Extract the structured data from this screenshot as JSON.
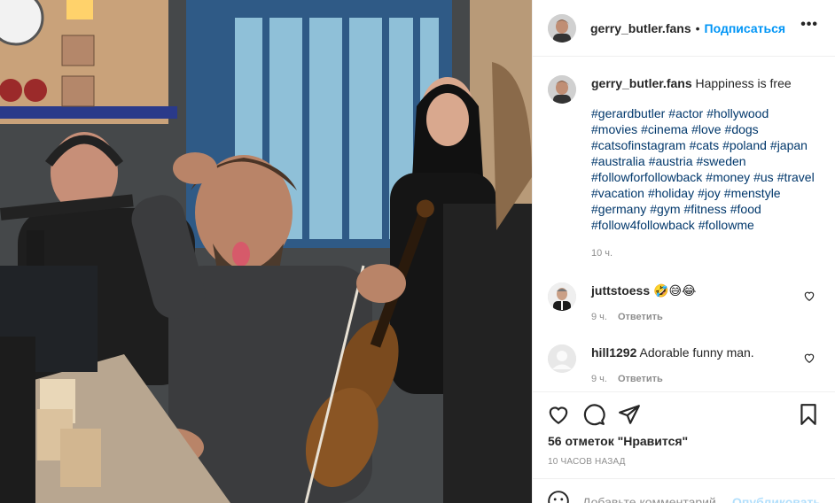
{
  "post": {
    "username": "gerry_butler.fans",
    "dot": "•",
    "follow_label": "Подписаться",
    "more_label": "•••"
  },
  "caption": {
    "username": "gerry_butler.fans",
    "text": "Happiness is free",
    "hashtags": [
      "#gerardbutler",
      "#actor",
      "#hollywood",
      "#movies",
      "#cinema",
      "#love",
      "#dogs",
      "#catsofinstagram",
      "#cats",
      "#poland",
      "#japan",
      "#australia",
      "#austria",
      "#sweden",
      "#followforfollowback",
      "#money",
      "#us",
      "#travel",
      "#vacation",
      "#holiday",
      "#joy",
      "#menstyle",
      "#germany",
      "#gym",
      "#fitness",
      "#food",
      "#follow4followback",
      "#followme"
    ],
    "time": "10 ч."
  },
  "comments": [
    {
      "username": "juttstoess",
      "text": "🤣😅😂",
      "time": "9 ч.",
      "reply_label": "Ответить"
    },
    {
      "username": "hill1292",
      "text": "Adorable funny man.",
      "time": "9 ч.",
      "reply_label": "Ответить"
    }
  ],
  "actions": {
    "icons": [
      "heart-icon",
      "comment-icon",
      "share-icon",
      "bookmark-icon"
    ],
    "likes": "56 отметок \"Нравится\"",
    "ago": "10 ЧАСОВ НАЗАД"
  },
  "add_comment": {
    "placeholder": "Добавьте комментарий...",
    "publish_label": "Опубликовать"
  }
}
